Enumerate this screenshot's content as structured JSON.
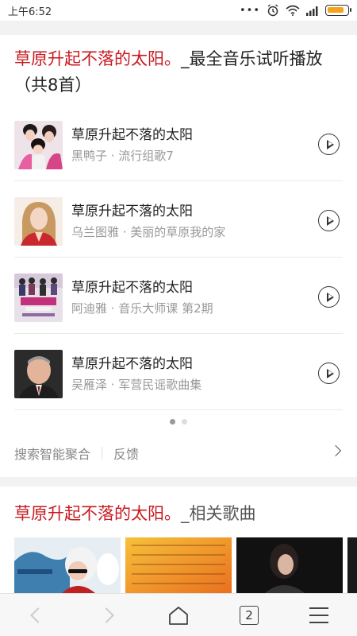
{
  "status": {
    "time": "上午6:52",
    "dots": "•••",
    "battery_level": 0.85,
    "battery_color": "#f5a31a"
  },
  "card1": {
    "title_red": "草原升起不落的太阳。",
    "title_rest": "_最全音乐试听播放（共8首）",
    "songs": [
      {
        "name": "草原升起不落的太阳",
        "sub": "黑鸭子 · 流行组歌7"
      },
      {
        "name": "草原升起不落的太阳",
        "sub": "乌兰图雅 · 美丽的草原我的家"
      },
      {
        "name": "草原升起不落的太阳",
        "sub": "阿迪雅 · 音乐大师课 第2期"
      },
      {
        "name": "草原升起不落的太阳",
        "sub": "吴雁泽 · 军营民谣歌曲集"
      }
    ],
    "pager_active": 1,
    "pager_total": 2,
    "footer_search": "搜索智能聚合",
    "footer_feedback": "反馈"
  },
  "card2": {
    "title_red": "草原升起不落的太阳。",
    "title_rest": "_相关歌曲"
  },
  "bottom": {
    "tab_count": "2"
  },
  "accent_color": "#c8191f"
}
